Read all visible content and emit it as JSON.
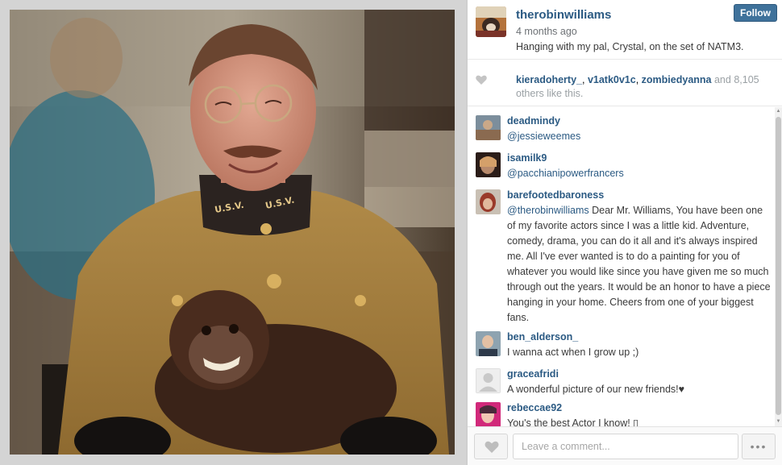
{
  "post": {
    "username": "therobinwilliams",
    "time": "4 months ago",
    "caption": "Hanging with my pal, Crystal, on the set of NATM3.",
    "follow_label": "Follow"
  },
  "likes": {
    "users": [
      "kieradoherty_",
      "v1atk0v1c",
      "zombiedyanna"
    ],
    "sep1": ", ",
    "sep2": ", ",
    "and_text": " and ",
    "count": "8,105",
    "tail": "others like this."
  },
  "comments": [
    {
      "user": "deadmindy",
      "mention": "@jessieweemes",
      "text": ""
    },
    {
      "user": "isamilk9",
      "mention": "@pacchianipowerfrancers",
      "text": ""
    },
    {
      "user": "barefootedbaroness",
      "mention": "@therobinwilliams",
      "text": " Dear Mr. Williams, You have been one of my favorite actors since I was a little kid. Adventure, comedy, drama, you can do it all and it's always inspired me. All I've ever wanted is to do a painting for you of whatever you would like since you have given me so much through out the years. It would be an honor to have a piece hanging in your home. Cheers from one of your biggest fans."
    },
    {
      "user": "ben_alderson_",
      "mention": "",
      "text": "I wanna act when I grow up ;)"
    },
    {
      "user": "graceafridi",
      "mention": "",
      "text": "A wonderful picture of our new friends!♥"
    },
    {
      "user": "rebeccae92",
      "mention": "",
      "text": "You's the best Actor I know! ▯"
    }
  ],
  "footer": {
    "comment_placeholder": "Leave a comment...",
    "more_label": "•••"
  },
  "photo": {
    "badge_left": "U.S.V.",
    "badge_right": "U.S.V."
  },
  "colors": {
    "link": "#2b5a83",
    "follow_bg": "#3f729b"
  }
}
